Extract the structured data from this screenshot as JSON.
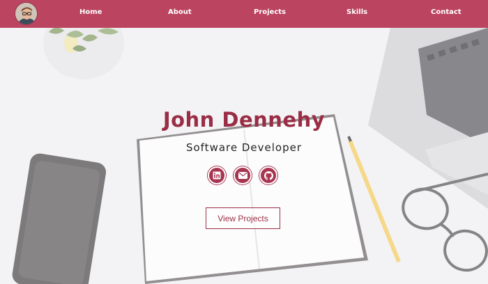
{
  "nav": {
    "links": [
      "Home",
      "About",
      "Projects",
      "Skills",
      "Contact"
    ],
    "avatar_icon": "profile-photo"
  },
  "hero": {
    "name": "John Dennehy",
    "role": "Software Developer",
    "socials": [
      {
        "icon": "linkedin-icon"
      },
      {
        "icon": "email-icon"
      },
      {
        "icon": "github-icon"
      }
    ],
    "cta_label": "View Projects"
  },
  "colors": {
    "nav_bg": "#bb4560",
    "accent": "#9a2d45",
    "social_bg": "#a63550",
    "page_bg": "#efeff1"
  }
}
